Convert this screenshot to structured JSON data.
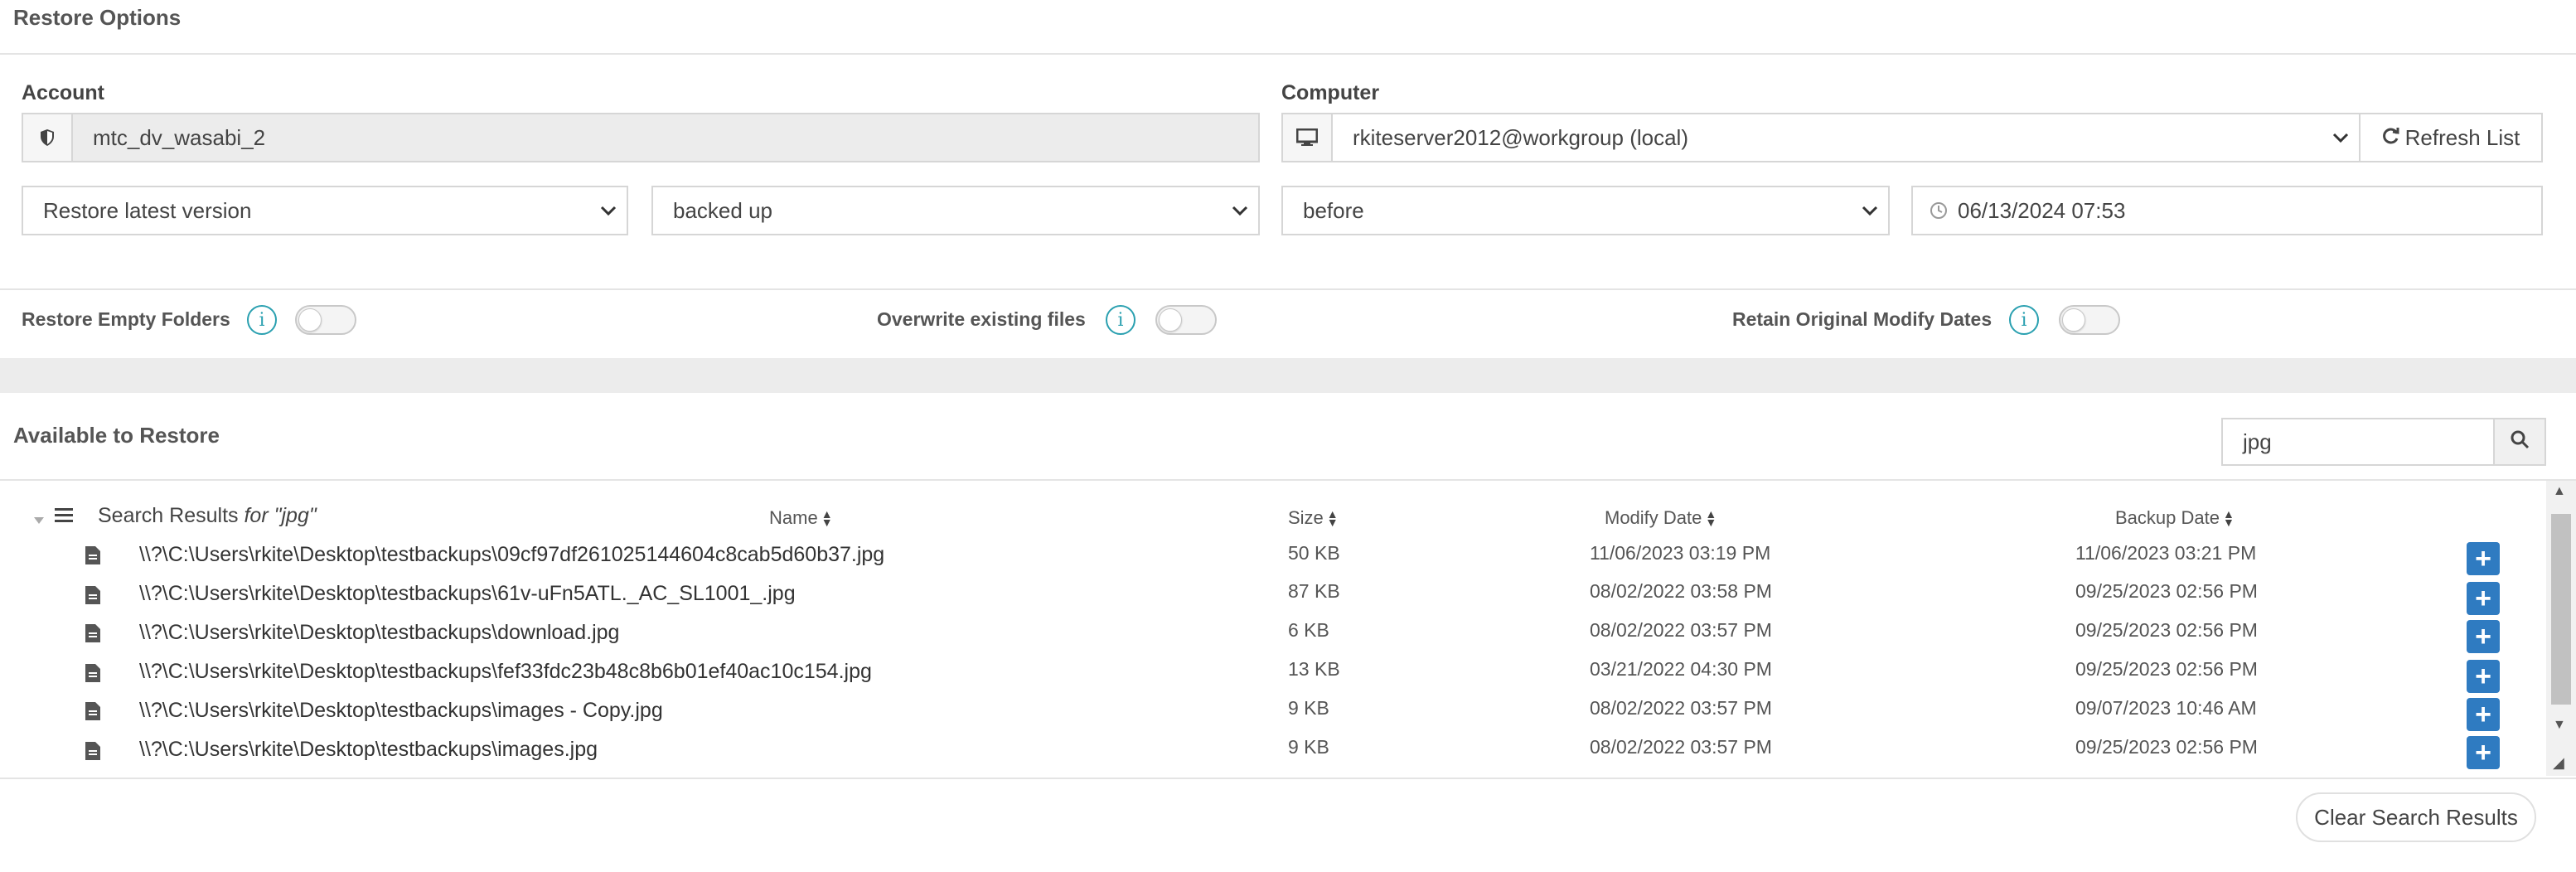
{
  "restore_options": {
    "title": "Restore Options",
    "account": {
      "label": "Account",
      "value": "mtc_dv_wasabi_2",
      "icon": "shield-icon"
    },
    "computer": {
      "label": "Computer",
      "value": "rkiteserver2012@workgroup (local)",
      "icon": "monitor-icon",
      "refresh_label": "Refresh List"
    },
    "version_select": "Restore latest version",
    "status_select": "backed up",
    "when_select": "before",
    "datetime": "06/13/2024 07:53",
    "toggles": [
      {
        "label": "Restore Empty Folders",
        "on": false
      },
      {
        "label": "Overwrite existing files",
        "on": false
      },
      {
        "label": "Retain Original Modify Dates",
        "on": false
      }
    ]
  },
  "available": {
    "title": "Available to Restore",
    "search_value": "jpg",
    "results_label": "Search Results",
    "results_query": "for \"jpg\"",
    "columns": {
      "name": "Name",
      "size": "Size",
      "modify": "Modify Date",
      "backup": "Backup Date"
    },
    "rows": [
      {
        "path": "\\\\?\\C:\\Users\\rkite\\Desktop\\testbackups\\09cf97df261025144604c8cab5d60b37.jpg",
        "size": "50 KB",
        "modify": "11/06/2023 03:19 PM",
        "backup": "11/06/2023 03:21 PM"
      },
      {
        "path": "\\\\?\\C:\\Users\\rkite\\Desktop\\testbackups\\61v-uFn5ATL._AC_SL1001_.jpg",
        "size": "87 KB",
        "modify": "08/02/2022 03:58 PM",
        "backup": "09/25/2023 02:56 PM"
      },
      {
        "path": "\\\\?\\C:\\Users\\rkite\\Desktop\\testbackups\\download.jpg",
        "size": "6 KB",
        "modify": "08/02/2022 03:57 PM",
        "backup": "09/25/2023 02:56 PM"
      },
      {
        "path": "\\\\?\\C:\\Users\\rkite\\Desktop\\testbackups\\fef33fdc23b48c8b6b01ef40ac10c154.jpg",
        "size": "13 KB",
        "modify": "03/21/2022 04:30 PM",
        "backup": "09/25/2023 02:56 PM"
      },
      {
        "path": "\\\\?\\C:\\Users\\rkite\\Desktop\\testbackups\\images - Copy.jpg",
        "size": "9 KB",
        "modify": "08/02/2022 03:57 PM",
        "backup": "09/07/2023 10:46 AM"
      },
      {
        "path": "\\\\?\\C:\\Users\\rkite\\Desktop\\testbackups\\images.jpg",
        "size": "9 KB",
        "modify": "08/02/2022 03:57 PM",
        "backup": "09/25/2023 02:56 PM"
      }
    ],
    "clear_label": "Clear Search Results"
  },
  "colors": {
    "accent": "#2f7bc1",
    "info": "#2aa0b0",
    "band": "#ececec"
  }
}
